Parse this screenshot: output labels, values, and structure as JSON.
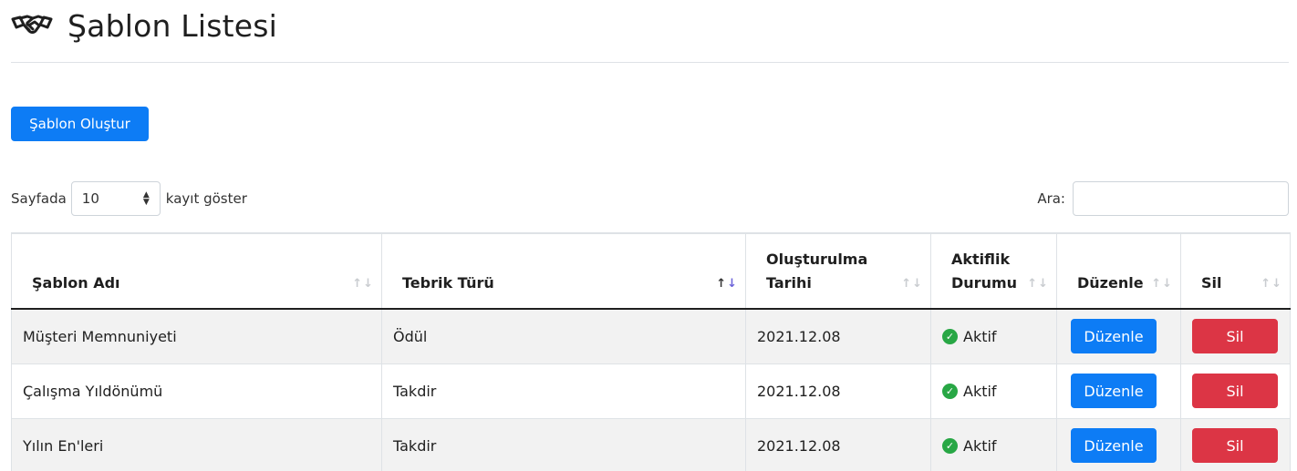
{
  "header": {
    "title": "Şablon Listesi",
    "icon": "handshake-icon"
  },
  "toolbar": {
    "create_label": "Şablon Oluştur"
  },
  "length": {
    "prefix": "Sayfada",
    "selected": "10",
    "suffix": "kayıt göster"
  },
  "search": {
    "label": "Ara:",
    "value": ""
  },
  "table": {
    "columns": [
      {
        "label": "Şablon Adı",
        "sort": "none"
      },
      {
        "label": "Tebrik Türü",
        "sort": "desc"
      },
      {
        "label": "Oluşturulma Tarihi",
        "sort": "none"
      },
      {
        "label": "Aktiflik Durumu",
        "sort": "none"
      },
      {
        "label": "Düzenle",
        "sort": "none"
      },
      {
        "label": "Sil",
        "sort": "none"
      }
    ],
    "rows": [
      {
        "name": "Müşteri Memnuniyeti",
        "type": "Ödül",
        "date": "2021.12.08",
        "status": "Aktif",
        "edit": "Düzenle",
        "delete": "Sil"
      },
      {
        "name": "Çalışma Yıldönümü",
        "type": "Takdir",
        "date": "2021.12.08",
        "status": "Aktif",
        "edit": "Düzenle",
        "delete": "Sil"
      },
      {
        "name": "Yılın En'leri",
        "type": "Takdir",
        "date": "2021.12.08",
        "status": "Aktif",
        "edit": "Düzenle",
        "delete": "Sil"
      }
    ]
  },
  "colors": {
    "primary": "#0d7cf5",
    "danger": "#dc3545",
    "success": "#28a745",
    "sort_active": "#6b62d9"
  }
}
